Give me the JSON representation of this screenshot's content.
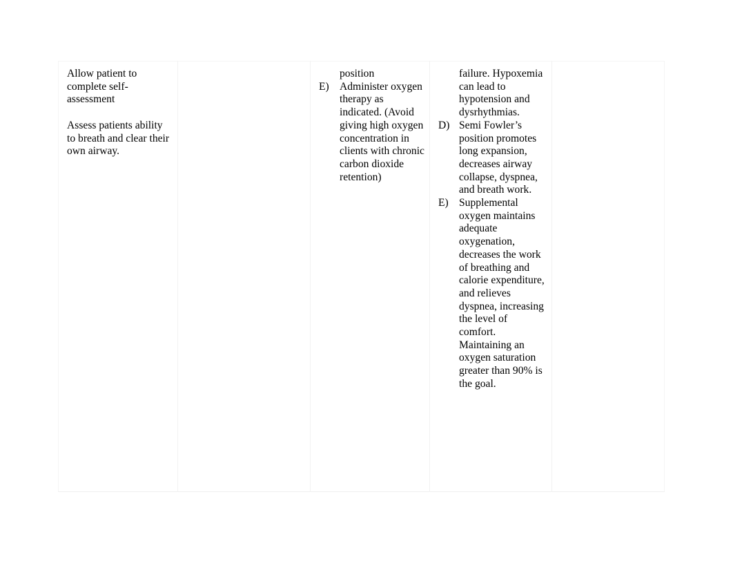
{
  "document": {
    "type": "nursing-care-plan-table",
    "page_background": "#ffffff",
    "text_color": "#000000",
    "border_color": "#f2f2f2"
  },
  "table": {
    "columns": [
      {
        "id": "column-1",
        "name": "assessment-column",
        "blocks": [
          {
            "kind": "paragraph",
            "text": "Allow patient to complete self-assessment"
          },
          {
            "kind": "spacer"
          },
          {
            "kind": "paragraph",
            "text": "Assess patients ability to breath and clear their own airway."
          }
        ]
      },
      {
        "id": "column-2",
        "name": "goal-column",
        "blocks": []
      },
      {
        "id": "column-3",
        "name": "intervention-column",
        "blocks": [
          {
            "kind": "continuation",
            "text": "position"
          },
          {
            "kind": "list-item",
            "marker": "E)",
            "text": "Administer oxygen therapy as indicated. (Avoid giving high oxygen concentration in clients with chronic carbon dioxide retention)"
          }
        ]
      },
      {
        "id": "column-4",
        "name": "rationale-column",
        "blocks": [
          {
            "kind": "continuation",
            "text": "failure. Hypoxemia can lead to hypotension and dysrhythmias."
          },
          {
            "kind": "list-item",
            "marker": "D)",
            "text": "Semi Fowler’s position promotes long expansion, decreases airway collapse, dyspnea, and breath work."
          },
          {
            "kind": "list-item",
            "marker": "E)",
            "text": "Supplemental oxygen maintains adequate oxygenation, decreases the work of breathing and calorie expenditure, and relieves dyspnea, increasing the level of comfort.",
            "text2": "Maintaining an oxygen saturation greater than 90% is the goal."
          }
        ]
      },
      {
        "id": "column-5",
        "name": "evaluation-column",
        "blocks": []
      }
    ]
  },
  "col1": {
    "para1": "Allow patient to complete self-assessment",
    "para2": "Assess patients ability to breath and clear their own airway."
  },
  "col3": {
    "continuation": "position",
    "item_e_marker": "E)",
    "item_e_text": "Administer oxygen therapy as indicated. (Avoid giving high oxygen concentration in clients with chronic carbon dioxide retention)"
  },
  "col4": {
    "continuation": "failure. Hypoxemia can lead to hypotension and dysrhythmias.",
    "item_d_marker": "D)",
    "item_d_text": "Semi Fowler’s position promotes long expansion, decreases airway collapse, dyspnea, and breath work.",
    "item_e_marker": "E)",
    "item_e_text": "Supplemental oxygen maintains adequate oxygenation, decreases the work of breathing and calorie expenditure, and relieves dyspnea, increasing the level of comfort.",
    "item_e_text2": "Maintaining an oxygen saturation greater than 90% is the goal."
  }
}
